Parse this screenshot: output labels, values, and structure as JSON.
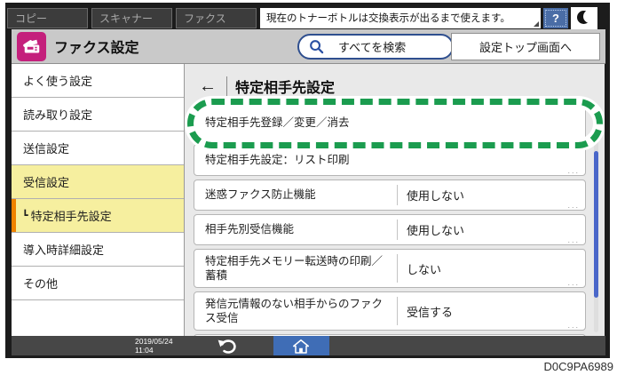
{
  "top_bar": {
    "tabs": [
      {
        "label": "コピー"
      },
      {
        "label": "スキャナー"
      },
      {
        "label": "ファクス"
      }
    ],
    "status_message": "現在のトナーボトルは交換表示が出るまで使えます。",
    "help_button": "?"
  },
  "title_bar": {
    "app_icon": "fax-machine-icon",
    "title": "ファクス設定",
    "search_button": "すべてを検索",
    "settings_top_button": "設定トップ画面へ"
  },
  "sidebar": {
    "items": [
      {
        "label": "よく使う設定",
        "selected": false
      },
      {
        "label": "読み取り設定",
        "selected": false
      },
      {
        "label": "送信設定",
        "selected": false
      },
      {
        "label": "受信設定",
        "selected": true
      },
      {
        "label": "特定相手先設定",
        "selected": true,
        "sub": true,
        "prefix": "┗"
      },
      {
        "label": "導入時詳細設定",
        "selected": false
      },
      {
        "label": "その他",
        "selected": false
      }
    ]
  },
  "main": {
    "back_button": "←",
    "title": "特定相手先設定",
    "items": [
      {
        "label": "特定相手先登録／変更／消去",
        "annotated": true
      },
      {
        "label": "特定相手先設定：リスト印刷",
        "more": "..."
      },
      {
        "label": "迷惑ファクス防止機能",
        "value": "使用しない",
        "more": "..."
      },
      {
        "label": "相手先別受信機能",
        "value": "使用しない",
        "more": "..."
      },
      {
        "label": "特定相手先メモリー転送時の印刷／蓄積",
        "value": "しない",
        "more": "..."
      },
      {
        "label": "発信元情報のない相手からのファクス受信",
        "value": "受信する",
        "more": "..."
      }
    ],
    "annotation": {
      "shape": "dashed-rounded-rect",
      "color": "#1b9c4f"
    }
  },
  "bottom_bar": {
    "date": "2019/05/24",
    "time": "11:04"
  },
  "caption": "D0C9PA6989",
  "colors": {
    "brand_magenta": "#c4207c",
    "selection_yellow": "#f6ef9f",
    "sub_orange": "#ef8200",
    "annotation_green": "#1b9c4f",
    "scrollbar_blue": "#4a67c9",
    "home_blue": "#3f6db6",
    "help_blue": "#4a6da6"
  }
}
